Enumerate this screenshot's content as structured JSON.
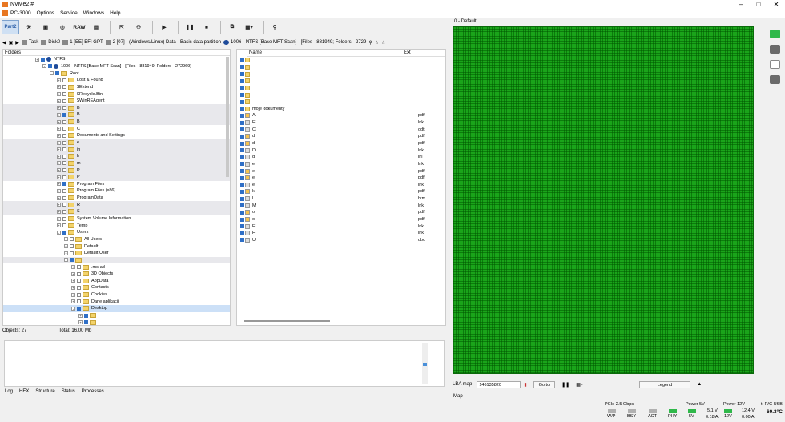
{
  "window": {
    "title": "NVMe2 #"
  },
  "menu": {
    "device": "PC-3000",
    "items": [
      "Options",
      "Service",
      "Windows",
      "Help"
    ]
  },
  "toolbar": {
    "part_label": "Part2",
    "raw_label": "RAW"
  },
  "pathbar": {
    "task": "Task",
    "disk": "Disk0",
    "p1": "1 [EE] EFI GPT",
    "p2": "2 [07] - (Windows/Linux) Data - Basic data partition",
    "p3": "1006 - NTFS [Base MFT Scan] - [Files - 881949; Folders - 2729"
  },
  "folders": {
    "header": "Folders",
    "rows": [
      {
        "label": "NTFS",
        "indent": 0,
        "type": "ntfs",
        "exp": "+",
        "chk": true
      },
      {
        "label": "1006 - NTFS [Base MFT Scan] - [Files - 881949; Folders - 272969]",
        "indent": 1,
        "type": "ntfs",
        "exp": "-",
        "chk": true
      },
      {
        "label": "Root",
        "indent": 2,
        "type": "folder",
        "exp": "-",
        "chk": true
      },
      {
        "label": "Lost & Found",
        "indent": 3,
        "type": "folder",
        "exp": "+",
        "chk": false
      },
      {
        "label": "$Extend",
        "indent": 3,
        "type": "folder",
        "exp": "+",
        "chk": false
      },
      {
        "label": "$Recycle.Bin",
        "indent": 3,
        "type": "folder",
        "exp": "+",
        "chk": false
      },
      {
        "label": "$WinREAgent",
        "indent": 3,
        "type": "folder",
        "exp": "+",
        "chk": false
      },
      {
        "label": "B",
        "indent": 3,
        "type": "folder",
        "exp": "+",
        "chk": false,
        "alt": true
      },
      {
        "label": "B",
        "indent": 3,
        "type": "folder",
        "exp": "+",
        "chk": true,
        "alt": true
      },
      {
        "label": "B",
        "indent": 3,
        "type": "folder",
        "exp": "+",
        "chk": false,
        "alt": true
      },
      {
        "label": "C",
        "indent": 3,
        "type": "folder",
        "exp": "+",
        "chk": false
      },
      {
        "label": "Documents and Settings",
        "indent": 3,
        "type": "folder",
        "exp": "+",
        "chk": false
      },
      {
        "label": "e",
        "indent": 3,
        "type": "folder",
        "exp": "+",
        "chk": false,
        "alt": true
      },
      {
        "label": "in",
        "indent": 3,
        "type": "folder",
        "exp": "+",
        "chk": false,
        "alt": true
      },
      {
        "label": "Ir",
        "indent": 3,
        "type": "folder",
        "exp": "+",
        "chk": false,
        "alt": true
      },
      {
        "label": "m",
        "indent": 3,
        "type": "folder",
        "exp": "+",
        "chk": false,
        "alt": true
      },
      {
        "label": "P",
        "indent": 3,
        "type": "folder",
        "exp": "+",
        "chk": false,
        "alt": true
      },
      {
        "label": "P",
        "indent": 3,
        "type": "folder",
        "exp": "+",
        "chk": false,
        "alt": true
      },
      {
        "label": "Program Files",
        "indent": 3,
        "type": "folder",
        "exp": "+",
        "chk": true
      },
      {
        "label": "Program Files (x86)",
        "indent": 3,
        "type": "folder",
        "exp": "+",
        "chk": false
      },
      {
        "label": "ProgramData",
        "indent": 3,
        "type": "folder",
        "exp": "+",
        "chk": false
      },
      {
        "label": "R",
        "indent": 3,
        "type": "folder",
        "exp": "+",
        "chk": false,
        "alt": true
      },
      {
        "label": "S",
        "indent": 3,
        "type": "folder",
        "exp": "+",
        "chk": false,
        "alt": true
      },
      {
        "label": "System Volume Information",
        "indent": 3,
        "type": "folder",
        "exp": "+",
        "chk": false
      },
      {
        "label": "Temp",
        "indent": 3,
        "type": "folder",
        "exp": "+",
        "chk": false
      },
      {
        "label": "Users",
        "indent": 3,
        "type": "folder",
        "exp": "-",
        "chk": true
      },
      {
        "label": "All Users",
        "indent": 4,
        "type": "folder",
        "exp": "+",
        "chk": false
      },
      {
        "label": "Default",
        "indent": 4,
        "type": "folder",
        "exp": "+",
        "chk": false
      },
      {
        "label": "Default User",
        "indent": 4,
        "type": "folder",
        "exp": "+",
        "chk": false
      },
      {
        "label": "",
        "indent": 4,
        "type": "folder",
        "exp": "-",
        "chk": true,
        "alt": true
      },
      {
        "label": ".ms-ad",
        "indent": 5,
        "type": "folder",
        "exp": "+",
        "chk": false
      },
      {
        "label": "3D Objects",
        "indent": 5,
        "type": "folder",
        "exp": "+",
        "chk": false
      },
      {
        "label": "AppData",
        "indent": 5,
        "type": "folder",
        "exp": "+",
        "chk": false
      },
      {
        "label": "Contacts",
        "indent": 5,
        "type": "folder",
        "exp": "+",
        "chk": false
      },
      {
        "label": "Cookies",
        "indent": 5,
        "type": "folder",
        "exp": "+",
        "chk": false
      },
      {
        "label": "Dane aplikacji",
        "indent": 5,
        "type": "folder",
        "exp": "+",
        "chk": false
      },
      {
        "label": "Desktop",
        "indent": 5,
        "type": "folder",
        "exp": "-",
        "chk": true,
        "sel": true
      },
      {
        "label": "",
        "indent": 6,
        "type": "folder",
        "exp": "+",
        "chk": true
      },
      {
        "label": "",
        "indent": 6,
        "type": "folder",
        "exp": "+",
        "chk": true
      }
    ]
  },
  "objects": {
    "count": "Objects: 27",
    "total": "Total: 16.00 Mb"
  },
  "files": {
    "col_name": "Name",
    "col_ext": "Ext",
    "rows": [
      {
        "name": "",
        "ext": "",
        "icon": "folder"
      },
      {
        "name": "",
        "ext": "",
        "icon": "folder"
      },
      {
        "name": "",
        "ext": "",
        "icon": "folder"
      },
      {
        "name": "",
        "ext": "",
        "icon": "folder"
      },
      {
        "name": "",
        "ext": "",
        "icon": "folder"
      },
      {
        "name": "",
        "ext": "",
        "icon": "folder"
      },
      {
        "name": "",
        "ext": "",
        "icon": "folder"
      },
      {
        "name": "moje dokumenty",
        "ext": "",
        "icon": "folder"
      },
      {
        "name": "A",
        "ext": "pdf",
        "icon": "pdf"
      },
      {
        "name": "E",
        "ext": "lnk",
        "icon": "file"
      },
      {
        "name": "C",
        "ext": "odt",
        "icon": "file"
      },
      {
        "name": "d",
        "ext": "pdf",
        "icon": "pdf"
      },
      {
        "name": "d",
        "ext": "pdf",
        "icon": "pdf"
      },
      {
        "name": "D",
        "ext": "lnk",
        "icon": "file"
      },
      {
        "name": "d",
        "ext": "ini",
        "icon": "file"
      },
      {
        "name": "e",
        "ext": "lnk",
        "icon": "file"
      },
      {
        "name": "e",
        "ext": "pdf",
        "icon": "pdf"
      },
      {
        "name": "e",
        "ext": "pdf",
        "icon": "pdf"
      },
      {
        "name": "e",
        "ext": "lnk",
        "icon": "file"
      },
      {
        "name": "k",
        "ext": "pdf",
        "icon": "pdf"
      },
      {
        "name": "L",
        "ext": "htm",
        "icon": "file"
      },
      {
        "name": "M",
        "ext": "lnk",
        "icon": "file"
      },
      {
        "name": "o",
        "ext": "pdf",
        "icon": "pdf"
      },
      {
        "name": "o",
        "ext": "pdf",
        "icon": "pdf"
      },
      {
        "name": "F",
        "ext": "lnk",
        "icon": "file"
      },
      {
        "name": "F",
        "ext": "lnk",
        "icon": "file"
      },
      {
        "name": "U",
        "ext": "doc",
        "icon": "file"
      }
    ]
  },
  "log_tabs": [
    "Log",
    "HEX",
    "Structure",
    "Status",
    "Processes"
  ],
  "map": {
    "title": "0 - Default",
    "lba_label": "LBA map",
    "lba_value": "146135820",
    "goto": "Go to",
    "legend": "Legend",
    "tab": "Map",
    "fill_color": "#1aa41a"
  },
  "status": {
    "pcie": "PCIe 2.5 Gbps",
    "wp": "W/P",
    "bsy": "BSY",
    "act": "ACT",
    "phy": "PHY",
    "p5v": "Power 5V",
    "v5": "5V",
    "p5v_volt": "5.1 V",
    "p5v_amp": "0.18 A",
    "p12v": "Power 12V",
    "v12": "12V",
    "p12v_volt": "12.4 V",
    "p12v_amp": "0.00 A",
    "temp_label": "t, R/C USB",
    "temp_value": "60.3°C"
  }
}
